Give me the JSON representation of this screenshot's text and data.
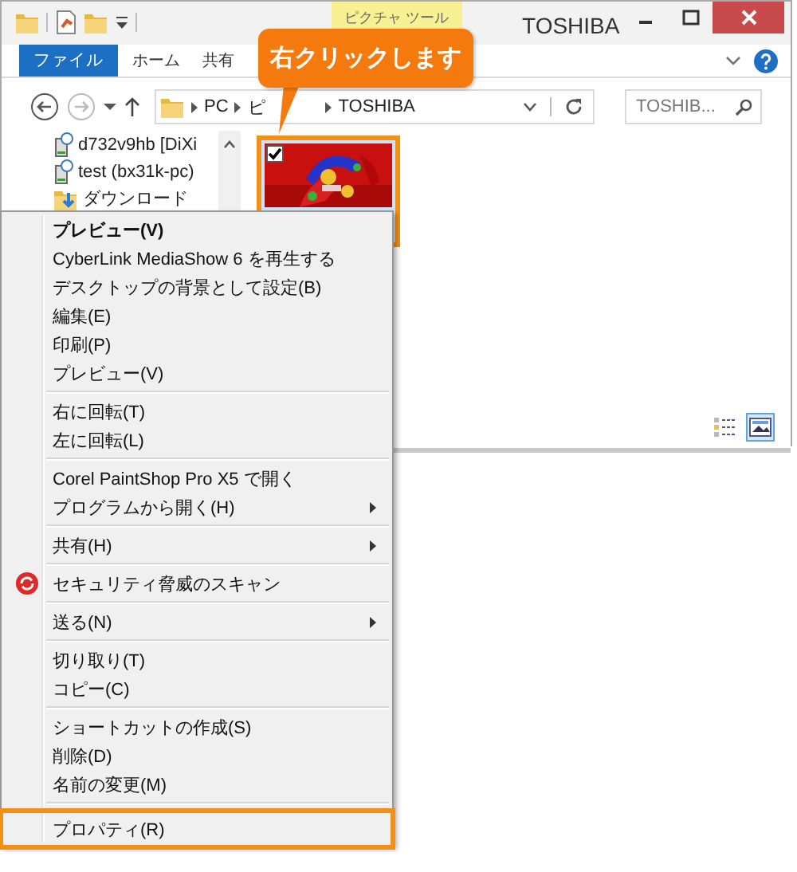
{
  "window": {
    "title": "TOSHIBA",
    "contextual_tab": "ピクチャ ツール"
  },
  "ribbon_tabs": [
    {
      "label": "ファイル",
      "kind": "file"
    },
    {
      "label": "ホーム",
      "kind": "tab"
    },
    {
      "label": "共有",
      "kind": "tab"
    }
  ],
  "address": {
    "segments": [
      "PC",
      "ピ",
      "TOSHIBA"
    ]
  },
  "search": {
    "placeholder": "TOSHIB..."
  },
  "nav_items": [
    {
      "label": "d732v9hb [DiXi",
      "kind": "network"
    },
    {
      "label": "test (bx31k-pc)",
      "kind": "network"
    },
    {
      "label": "ダウンロード",
      "kind": "download"
    }
  ],
  "files": [
    {
      "kind": "picture",
      "checked": true,
      "selected": true,
      "highlighted": true
    }
  ],
  "view_buttons": [
    {
      "kind": "details",
      "selected": false
    },
    {
      "kind": "large-icons",
      "selected": true
    }
  ],
  "callout": {
    "text": "右クリックします"
  },
  "context_menu": [
    {
      "kind": "item",
      "label": "プレビュー(V)",
      "bold": true,
      "submenu": false,
      "highlighted": false
    },
    {
      "kind": "item",
      "label": "CyberLink MediaShow 6 を再生する",
      "bold": false,
      "submenu": false,
      "highlighted": false
    },
    {
      "kind": "item",
      "label": "デスクトップの背景として設定(B)",
      "bold": false,
      "submenu": false,
      "highlighted": false
    },
    {
      "kind": "item",
      "label": "編集(E)",
      "bold": false,
      "submenu": false,
      "highlighted": false
    },
    {
      "kind": "item",
      "label": "印刷(P)",
      "bold": false,
      "submenu": false,
      "highlighted": false
    },
    {
      "kind": "item",
      "label": "プレビュー(V)",
      "bold": false,
      "submenu": false,
      "highlighted": false
    },
    {
      "kind": "separator"
    },
    {
      "kind": "item",
      "label": "右に回転(T)",
      "bold": false,
      "submenu": false,
      "highlighted": false
    },
    {
      "kind": "item",
      "label": "左に回転(L)",
      "bold": false,
      "submenu": false,
      "highlighted": false
    },
    {
      "kind": "separator"
    },
    {
      "kind": "item",
      "label": "Corel PaintShop Pro X5 で開く",
      "bold": false,
      "submenu": false,
      "highlighted": false
    },
    {
      "kind": "item",
      "label": "プログラムから開く(H)",
      "bold": false,
      "submenu": true,
      "highlighted": false
    },
    {
      "kind": "separator"
    },
    {
      "kind": "item",
      "label": "共有(H)",
      "bold": false,
      "submenu": true,
      "highlighted": false
    },
    {
      "kind": "separator"
    },
    {
      "kind": "scan",
      "label": "セキュリティ脅威のスキャン",
      "bold": false,
      "submenu": false,
      "highlighted": false
    },
    {
      "kind": "separator"
    },
    {
      "kind": "item",
      "label": "送る(N)",
      "bold": false,
      "submenu": true,
      "highlighted": false
    },
    {
      "kind": "separator"
    },
    {
      "kind": "item",
      "label": "切り取り(T)",
      "bold": false,
      "submenu": false,
      "highlighted": false
    },
    {
      "kind": "item",
      "label": "コピー(C)",
      "bold": false,
      "submenu": false,
      "highlighted": false
    },
    {
      "kind": "separator"
    },
    {
      "kind": "item",
      "label": "ショートカットの作成(S)",
      "bold": false,
      "submenu": false,
      "highlighted": false
    },
    {
      "kind": "item",
      "label": "削除(D)",
      "bold": false,
      "submenu": false,
      "highlighted": false
    },
    {
      "kind": "item",
      "label": "名前の変更(M)",
      "bold": false,
      "submenu": false,
      "highlighted": false
    },
    {
      "kind": "separator"
    },
    {
      "kind": "item",
      "label": "プロパティ(R)",
      "bold": false,
      "submenu": false,
      "highlighted": true
    }
  ]
}
